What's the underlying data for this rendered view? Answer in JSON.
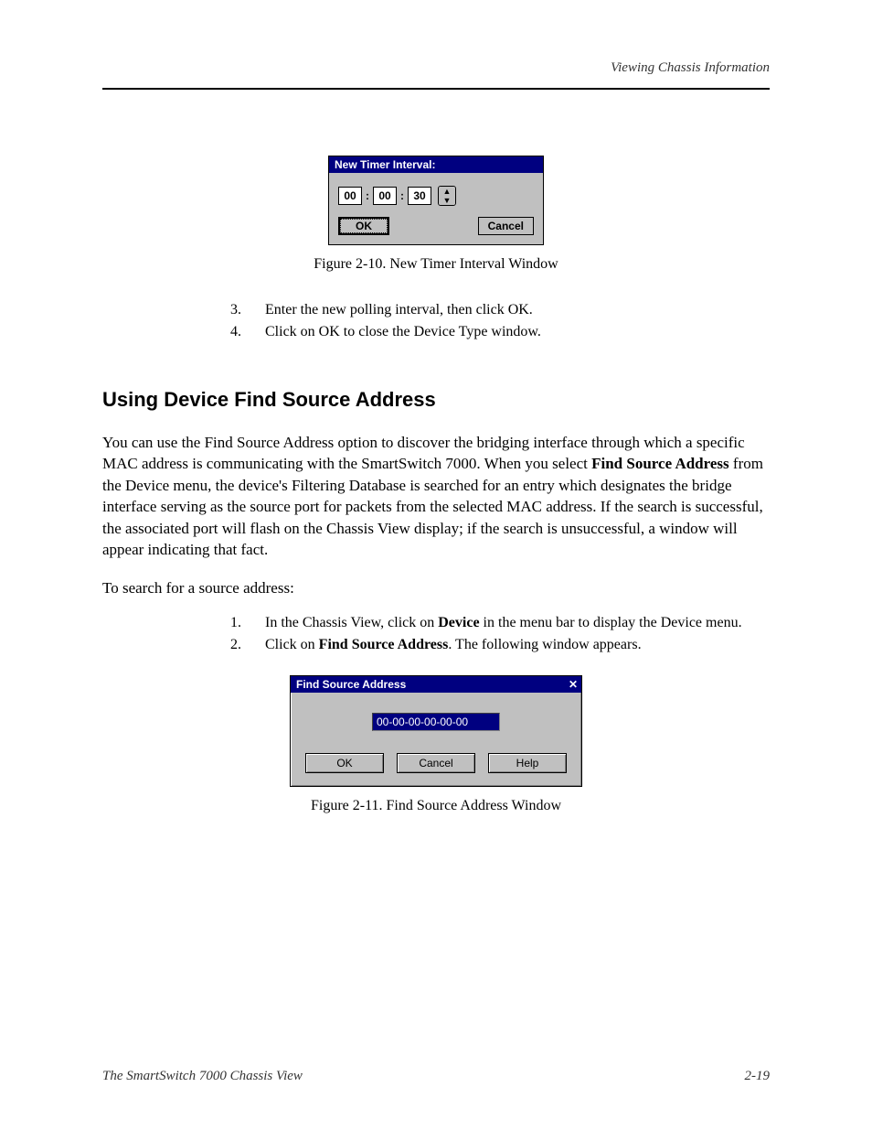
{
  "header": {
    "right_title": "Viewing Chassis Information"
  },
  "dialog1": {
    "title": "New Timer Interval:",
    "hours": "00",
    "minutes": "00",
    "seconds": "30",
    "ok": "OK",
    "cancel": "Cancel"
  },
  "figure1_caption": "Figure 2-10.  New Timer Interval Window",
  "steps1": [
    {
      "num": "3.",
      "text": "Enter the new polling interval, then click OK."
    },
    {
      "num": "4.",
      "text": "Click on OK to close the Device Type window."
    }
  ],
  "section_heading": "Using Device Find Source Address",
  "paragraph1": "You can use the Find Source Address option to discover the bridging interface through which a specific MAC address is communicating with the SmartSwitch 7000. When you select Find Source Address from the Device menu, the device's Filtering Database is searched for an entry which designates the bridge interface serving as the source port for packets from the selected MAC address. If the search is successful, the associated port will flash on the Chassis View display; if the search is unsuccessful, a window will appear indicating that fact.",
  "paragraph2": "To search for a source address:",
  "steps2": [
    {
      "num": "1.",
      "text": "In the Chassis View, click on Device in the menu bar to display the Device menu."
    },
    {
      "num": "2.",
      "text": "Click on Find Source Address. The following window appears."
    }
  ],
  "dialog2": {
    "title": "Find Source Address",
    "mac": "00-00-00-00-00-00",
    "ok": "OK",
    "cancel": "Cancel",
    "help": "Help"
  },
  "figure2_caption": "Figure 2-11.  Find Source Address Window",
  "footer": {
    "left": "The SmartSwitch 7000 Chassis View",
    "right": "2-19"
  }
}
